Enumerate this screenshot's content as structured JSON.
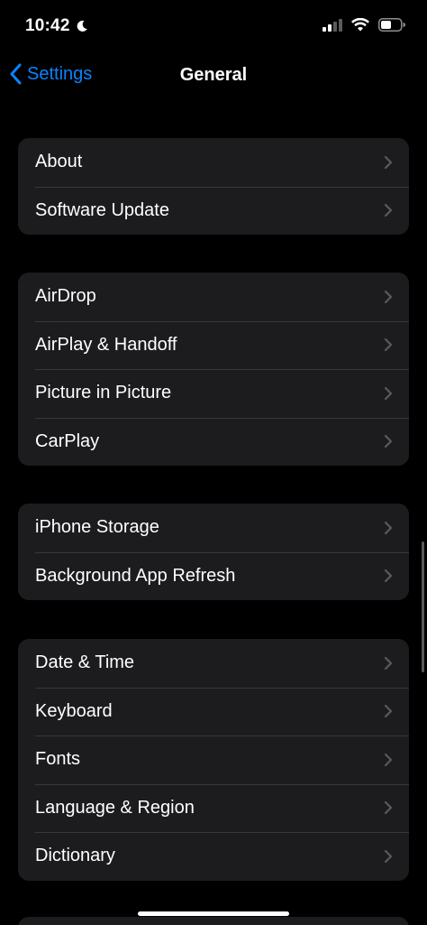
{
  "status_bar": {
    "time": "10:42"
  },
  "nav": {
    "back_label": "Settings",
    "title": "General"
  },
  "groups": [
    {
      "items": [
        {
          "label": "About"
        },
        {
          "label": "Software Update"
        }
      ]
    },
    {
      "items": [
        {
          "label": "AirDrop"
        },
        {
          "label": "AirPlay & Handoff"
        },
        {
          "label": "Picture in Picture"
        },
        {
          "label": "CarPlay"
        }
      ]
    },
    {
      "items": [
        {
          "label": "iPhone Storage"
        },
        {
          "label": "Background App Refresh"
        }
      ]
    },
    {
      "items": [
        {
          "label": "Date & Time"
        },
        {
          "label": "Keyboard"
        },
        {
          "label": "Fonts"
        },
        {
          "label": "Language & Region"
        },
        {
          "label": "Dictionary"
        }
      ]
    }
  ],
  "colors": {
    "background": "#000000",
    "group_background": "#1c1c1e",
    "accent": "#0a84ff",
    "separator": "#38383a",
    "chevron": "#5a5a5e"
  },
  "icons": {
    "moon": "moon-icon",
    "signal": "cellular-signal-icon",
    "wifi": "wifi-icon",
    "battery": "battery-icon",
    "back": "chevron-left-icon",
    "row": "chevron-right-icon"
  }
}
